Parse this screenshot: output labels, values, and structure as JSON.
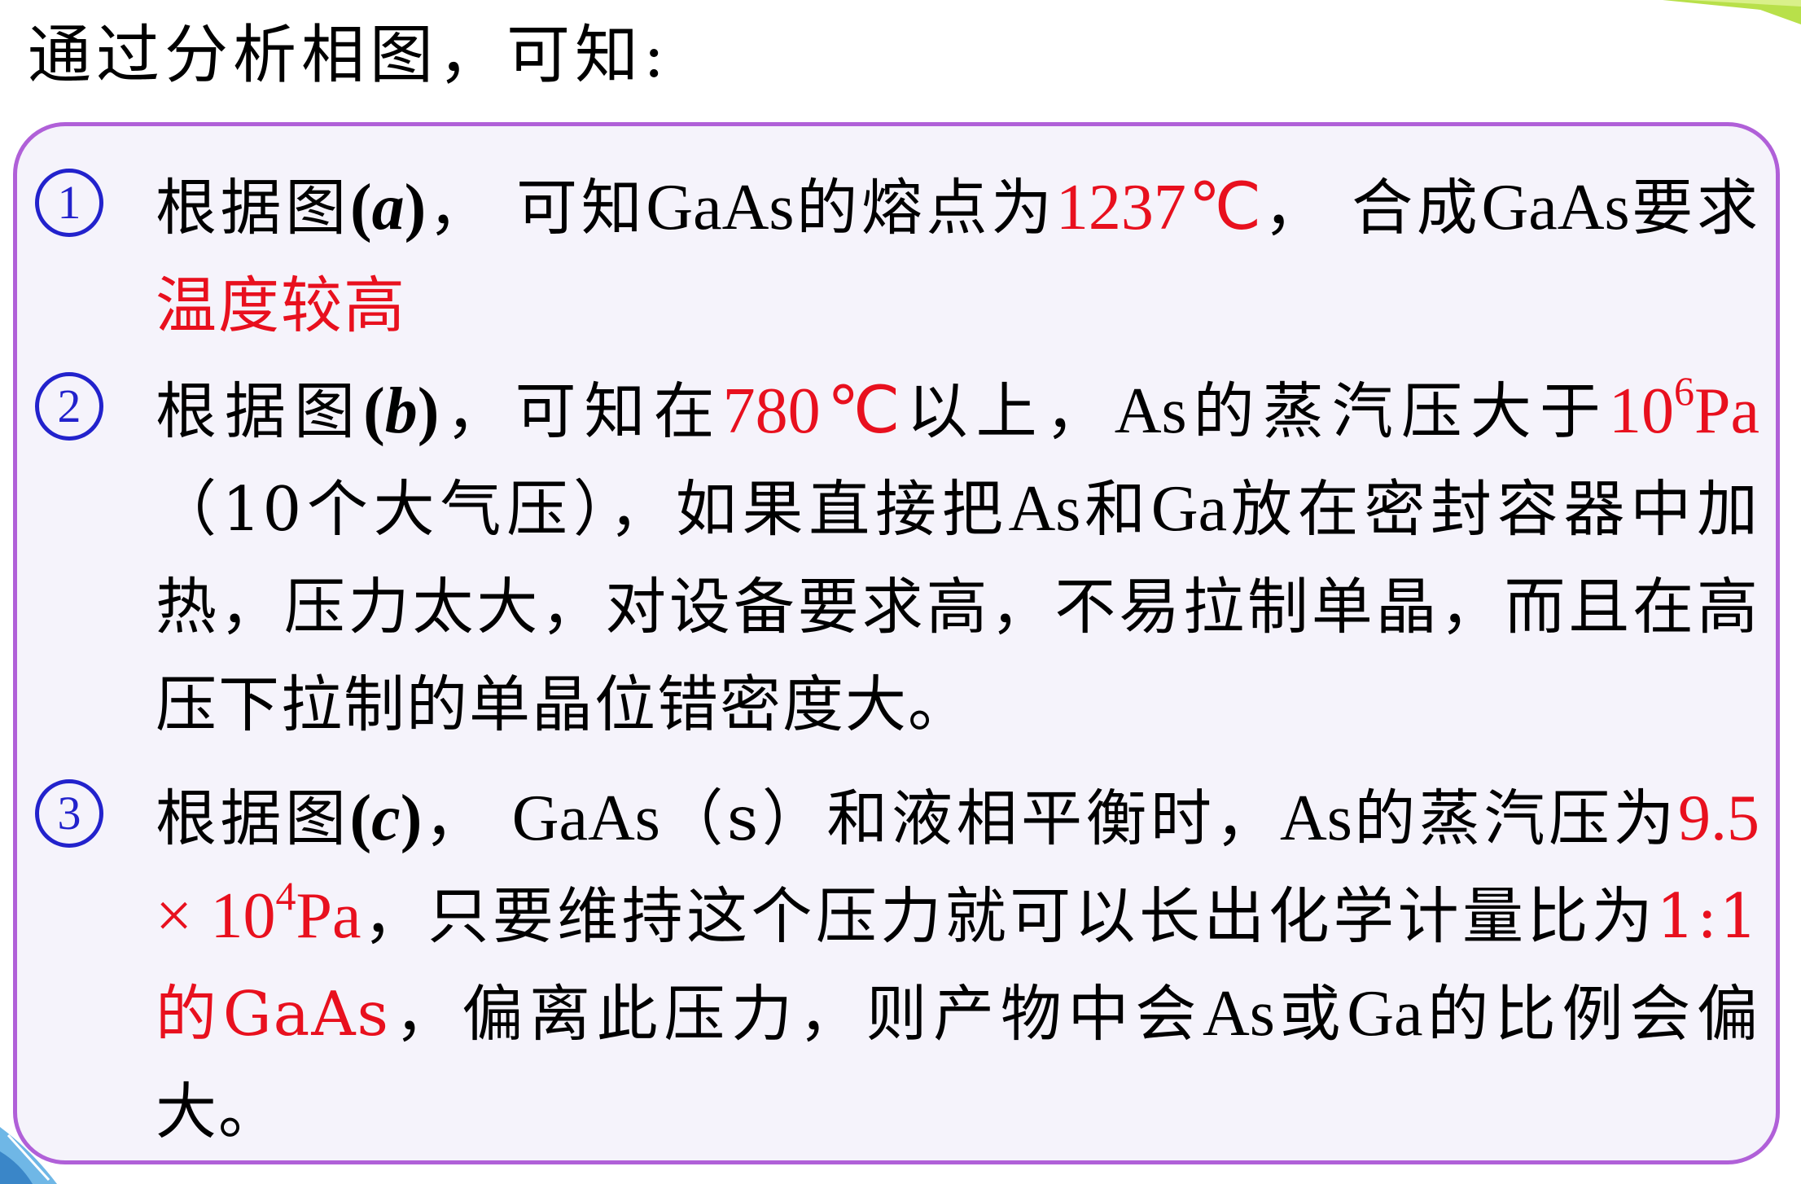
{
  "heading": "通过分析相图，可知:",
  "colors": {
    "text": "#000000",
    "highlight": "#e8101e",
    "marker": "#2222cc",
    "panel_border": "#b060d8",
    "panel_fill": "#f5f3fb"
  },
  "items": [
    {
      "marker": "1",
      "segments": {
        "s1": "根据图",
        "fig_open": "(",
        "fig_letter": "a",
        "fig_close": ")",
        "s2": "，  可知",
        "s3": "GaAs",
        "s4": "的熔点为",
        "s5_red": "1237℃",
        "s6": "，  合成",
        "s7": "GaAs",
        "s8": "要求",
        "s9_red": "温度较高"
      }
    },
    {
      "marker": "2",
      "segments": {
        "s1": "根据图",
        "fig_open": "(",
        "fig_letter": "b",
        "fig_close": ")",
        "s2": "，可知在",
        "s3_red": "780℃",
        "s4": "以上，",
        "s5": "As",
        "s6": "的蒸汽压大于",
        "s7_red_base": "10",
        "s7_red_sup": "6",
        "s7_red_unit": "Pa",
        "s8": "（10个大气压），如果直接把",
        "s9": "As",
        "s10": "和",
        "s11": "Ga",
        "s12": "放在密封容器中加热，压力太大，对设备要求高，不易拉制单晶，而且在高压下拉制的单晶位错密度大。"
      }
    },
    {
      "marker": "3",
      "segments": {
        "s1": "根据图",
        "fig_open": "(",
        "fig_letter": "c",
        "fig_close": ")",
        "s2": "，  ",
        "s3": "GaAs",
        "s4": "（s）和液相平衡时，",
        "s5": "As",
        "s6": "的蒸汽压为",
        "s7_red_base": "9.5 × 10",
        "s7_red_sup": "4",
        "s7_red_unit": "Pa",
        "s8": "，只要维持这个压力就可以长出化学计量比为",
        "s9_red": "1:1的GaAs",
        "s10": "，偏离此压力，则产物中会",
        "s11": "As",
        "s12": "或",
        "s13": "Ga",
        "s14": "的比例会偏大。"
      }
    }
  ]
}
